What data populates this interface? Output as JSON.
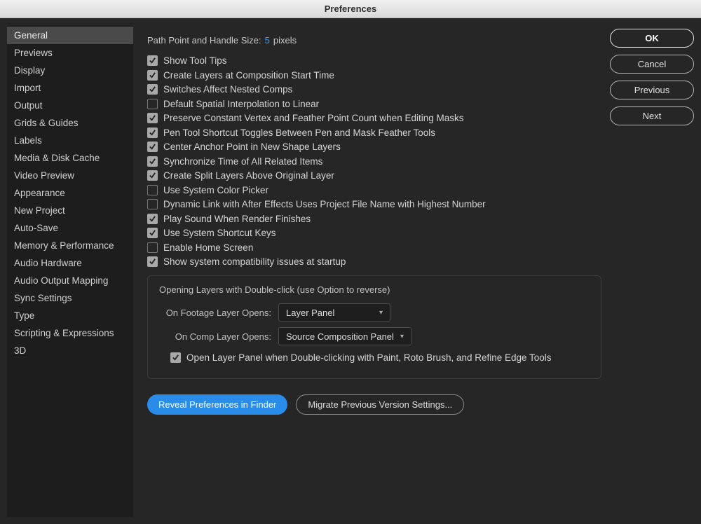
{
  "window": {
    "title": "Preferences"
  },
  "sidebar": {
    "items": [
      "General",
      "Previews",
      "Display",
      "Import",
      "Output",
      "Grids & Guides",
      "Labels",
      "Media & Disk Cache",
      "Video Preview",
      "Appearance",
      "New Project",
      "Auto-Save",
      "Memory & Performance",
      "Audio Hardware",
      "Audio Output Mapping",
      "Sync Settings",
      "Type",
      "Scripting & Expressions",
      "3D"
    ],
    "selected_index": 0
  },
  "buttons": {
    "ok": "OK",
    "cancel": "Cancel",
    "previous": "Previous",
    "next": "Next"
  },
  "path_row": {
    "label": "Path Point and Handle Size:",
    "value": "5",
    "unit": "pixels"
  },
  "checks": [
    {
      "label": "Show Tool Tips",
      "checked": true
    },
    {
      "label": "Create Layers at Composition Start Time",
      "checked": true
    },
    {
      "label": "Switches Affect Nested Comps",
      "checked": true
    },
    {
      "label": "Default Spatial Interpolation to Linear",
      "checked": false
    },
    {
      "label": "Preserve Constant Vertex and Feather Point Count when Editing Masks",
      "checked": true
    },
    {
      "label": "Pen Tool Shortcut Toggles Between Pen and Mask Feather Tools",
      "checked": true
    },
    {
      "label": "Center Anchor Point in New Shape Layers",
      "checked": true
    },
    {
      "label": "Synchronize Time of All Related Items",
      "checked": true
    },
    {
      "label": "Create Split Layers Above Original Layer",
      "checked": true
    },
    {
      "label": "Use System Color Picker",
      "checked": false
    },
    {
      "label": "Dynamic Link with After Effects Uses Project File Name with Highest Number",
      "checked": false
    },
    {
      "label": "Play Sound When Render Finishes",
      "checked": true
    },
    {
      "label": "Use System Shortcut Keys",
      "checked": true
    },
    {
      "label": "Enable Home Screen",
      "checked": false
    },
    {
      "label": "Show system compatibility issues at startup",
      "checked": true
    }
  ],
  "group": {
    "legend": "Opening Layers with Double-click (use Option to reverse)",
    "footage_label": "On Footage Layer Opens:",
    "footage_value": "Layer Panel",
    "comp_label": "On Comp Layer Opens:",
    "comp_value": "Source Composition Panel",
    "open_panel_check": {
      "label": "Open Layer Panel when Double-clicking with Paint, Roto Brush, and Refine Edge Tools",
      "checked": true
    }
  },
  "bottom": {
    "reveal": "Reveal Preferences in Finder",
    "migrate": "Migrate Previous Version Settings..."
  }
}
